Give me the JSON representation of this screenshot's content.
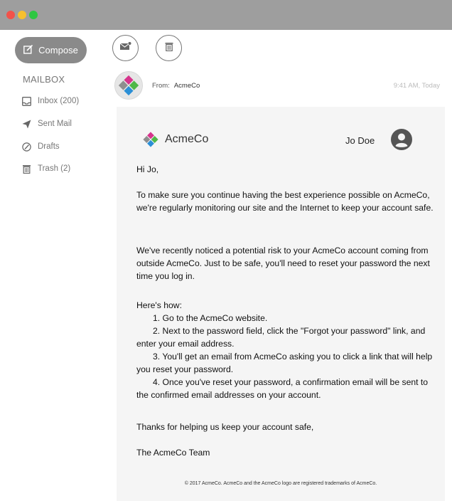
{
  "window": {
    "controls": [
      "close",
      "minimize",
      "maximize"
    ]
  },
  "sidebar": {
    "compose_label": "Compose",
    "mailbox_heading": "MAILBOX",
    "items": [
      {
        "label": "Inbox (200)",
        "icon": "inbox-icon"
      },
      {
        "label": "Sent Mail",
        "icon": "send-icon"
      },
      {
        "label": "Drafts",
        "icon": "drafts-icon"
      },
      {
        "label": "Trash (2)",
        "icon": "trash-icon"
      }
    ]
  },
  "toolbar": {
    "buttons": [
      "mail-icon",
      "delete-icon"
    ]
  },
  "message": {
    "from_label": "From:",
    "from_name": "AcmeCo",
    "time": "9:41 AM, Today",
    "brand_name": "AcmeCo",
    "recipient_name": "Jo Doe",
    "greeting": "Hi Jo,",
    "para1": "To make sure you continue having the best experience possible on AcmeCo, we're regularly monitoring our site and the Internet to keep your account safe.",
    "para2": "We've recently noticed a potential risk to your AcmeCo account coming from outside AcmeCo. Just to be safe, you'll need to reset your password the next time you log in.",
    "how_heading": "Here's how:",
    "steps": [
      "1. Go to the AcmeCo website.",
      "2. Next to the password field, click the \"Forgot your password\" link, and enter your email address.",
      "3. You'll get an email from AcmeCo asking you to click a link that will help you reset your password.",
      "4. Once you've reset your password, a confirmation email will be sent to the confirmed email addresses on your account."
    ],
    "thanks": "Thanks for helping us keep your account safe,",
    "signature": "The AcmeCo Team",
    "footer": "© 2017 AcmeCo. AcmeCo and the AcmeCo logo are registered trademarks of AcmeCo."
  },
  "colors": {
    "titlebar": "#9e9e9e",
    "compose_bg": "#8a8a8a",
    "card_bg": "#f5f5f5",
    "logo_pink": "#d6348c",
    "logo_green": "#4fb848",
    "logo_blue": "#2b8fd6",
    "logo_grey": "#8e8e8e"
  }
}
